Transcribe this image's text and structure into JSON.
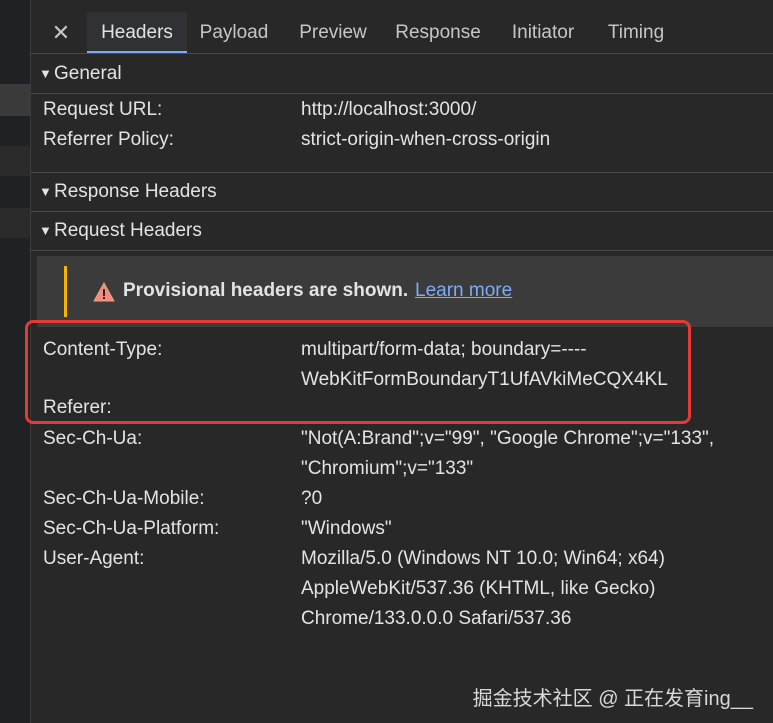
{
  "tabs": {
    "close": "✕",
    "items": [
      {
        "label": "Headers",
        "active": true
      },
      {
        "label": "Payload",
        "active": false
      },
      {
        "label": "Preview",
        "active": false
      },
      {
        "label": "Response",
        "active": false
      },
      {
        "label": "Initiator",
        "active": false
      },
      {
        "label": "Timing",
        "active": false
      }
    ]
  },
  "general": {
    "title": "General",
    "rows": [
      {
        "key": "Request URL:",
        "value": "http://localhost:3000/"
      },
      {
        "key": "Referrer Policy:",
        "value": "strict-origin-when-cross-origin"
      }
    ]
  },
  "response_headers": {
    "title": "Response Headers"
  },
  "request_headers": {
    "title": "Request Headers",
    "warning": {
      "text": "Provisional headers are shown.",
      "link": "Learn more"
    },
    "rows": [
      {
        "key": "Content-Type:",
        "value_lines": [
          "multipart/form-data; boundary=----",
          "WebKitFormBoundaryT1UfAVkiMeCQX4KL"
        ]
      },
      {
        "key": "Referer:",
        "value_lines": []
      },
      {
        "key": "Sec-Ch-Ua:",
        "value_lines": [
          "\"Not(A:Brand\";v=\"99\", \"Google Chrome\";v=\"133\",",
          "\"Chromium\";v=\"133\""
        ]
      },
      {
        "key": "Sec-Ch-Ua-Mobile:",
        "value_lines": [
          "?0"
        ]
      },
      {
        "key": "Sec-Ch-Ua-Platform:",
        "value_lines": [
          "\"Windows\""
        ]
      },
      {
        "key": "User-Agent:",
        "value_lines": [
          "Mozilla/5.0 (Windows NT 10.0; Win64; x64)",
          "AppleWebKit/537.36 (KHTML, like Gecko)",
          "Chrome/133.0.0.0 Safari/537.36"
        ]
      }
    ]
  },
  "watermark": "掘金技术社区 @ 正在发育ing__",
  "colors": {
    "accent": "#7cacf8",
    "warning": "#f4b400",
    "highlight": "#e53935"
  }
}
